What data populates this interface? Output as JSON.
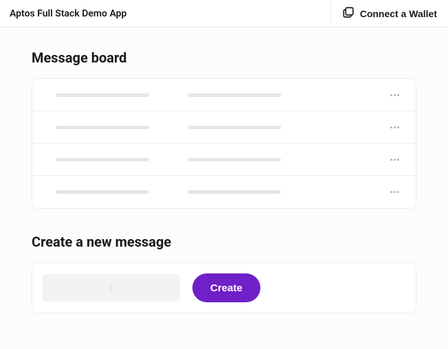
{
  "header": {
    "app_title": "Aptos Full Stack Demo App",
    "connect_label": "Connect a Wallet"
  },
  "board": {
    "title": "Message board",
    "rows": [
      {},
      {},
      {},
      {}
    ]
  },
  "create": {
    "title": "Create a new message",
    "input_value": "1",
    "button_label": "Create"
  },
  "colors": {
    "accent": "#6f20c7"
  }
}
